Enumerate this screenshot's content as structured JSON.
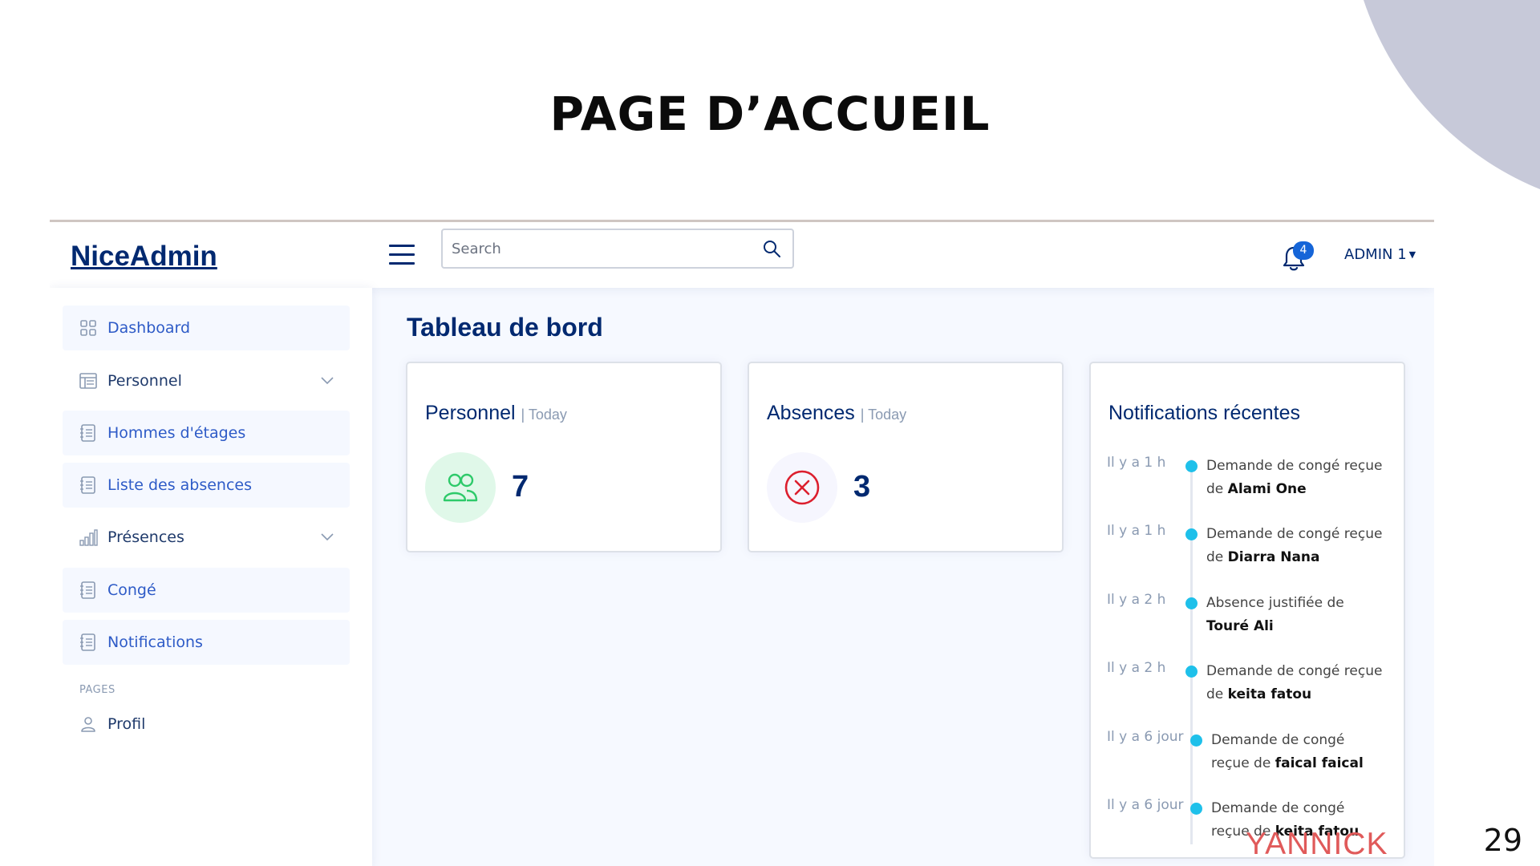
{
  "slide": {
    "title": "PAGE D’ACCUEIL",
    "page_number": "29",
    "watermark": "YANNICK"
  },
  "colors": {
    "brand": "#012970",
    "accent": "#1565d8",
    "timeline_dot": "#1ec0ea",
    "corner_shape": "#c7c9d9",
    "personnel_icon_bg": "#e0f8e9",
    "absence_icon_bg": "#f6f6fe"
  },
  "header": {
    "logo": "NiceAdmin",
    "toggle_icon": "hamburger-icon",
    "search": {
      "placeholder": "Search",
      "value": "",
      "icon": "search-icon"
    },
    "notifications": {
      "icon": "bell-icon",
      "count": "4"
    },
    "profile": {
      "name": "ADMIN 1"
    }
  },
  "sidebar": {
    "items": [
      {
        "label": "Dashboard",
        "icon": "grid-icon"
      },
      {
        "label": "Personnel",
        "icon": "table-icon",
        "chevron": "chevron-down-icon"
      },
      {
        "label": "Hommes d'étages",
        "icon": "journal-icon"
      },
      {
        "label": "Liste des absences",
        "icon": "journal-icon"
      },
      {
        "label": "Présences",
        "icon": "bar-chart-icon",
        "chevron": "chevron-down-icon"
      },
      {
        "label": "Congé",
        "icon": "journal-icon"
      },
      {
        "label": "Notifications",
        "icon": "journal-icon"
      }
    ],
    "heading": "PAGES",
    "pages": [
      {
        "label": "Profil",
        "icon": "person-icon"
      }
    ]
  },
  "main": {
    "title": "Tableau de bord",
    "cards": [
      {
        "title": "Personnel",
        "filter": "| Today",
        "value": "7",
        "icon": "people-icon"
      },
      {
        "title": "Absences",
        "filter": "| Today",
        "value": "3",
        "icon": "x-circle-icon"
      }
    ],
    "notifications": {
      "title": "Notifications récentes",
      "items": [
        {
          "time": "Il y a 1 h",
          "text": "Demande de congé reçue de",
          "name": "Alami One"
        },
        {
          "time": "Il y a 1 h",
          "text": "Demande de congé reçue de",
          "name": "Diarra Nana"
        },
        {
          "time": "Il y a 2 h",
          "text": "Absence justifiée de",
          "name": "Touré Ali"
        },
        {
          "time": "Il y a 2 h",
          "text": "Demande de congé reçue de",
          "name": "keita fatou"
        },
        {
          "time": "Il y a 6 jour",
          "text": "Demande de congé reçue de",
          "name": "faical faical"
        },
        {
          "time": "Il y a 6 jour",
          "text": "Demande de congé reçue de",
          "name": "keita fatou"
        }
      ]
    }
  }
}
